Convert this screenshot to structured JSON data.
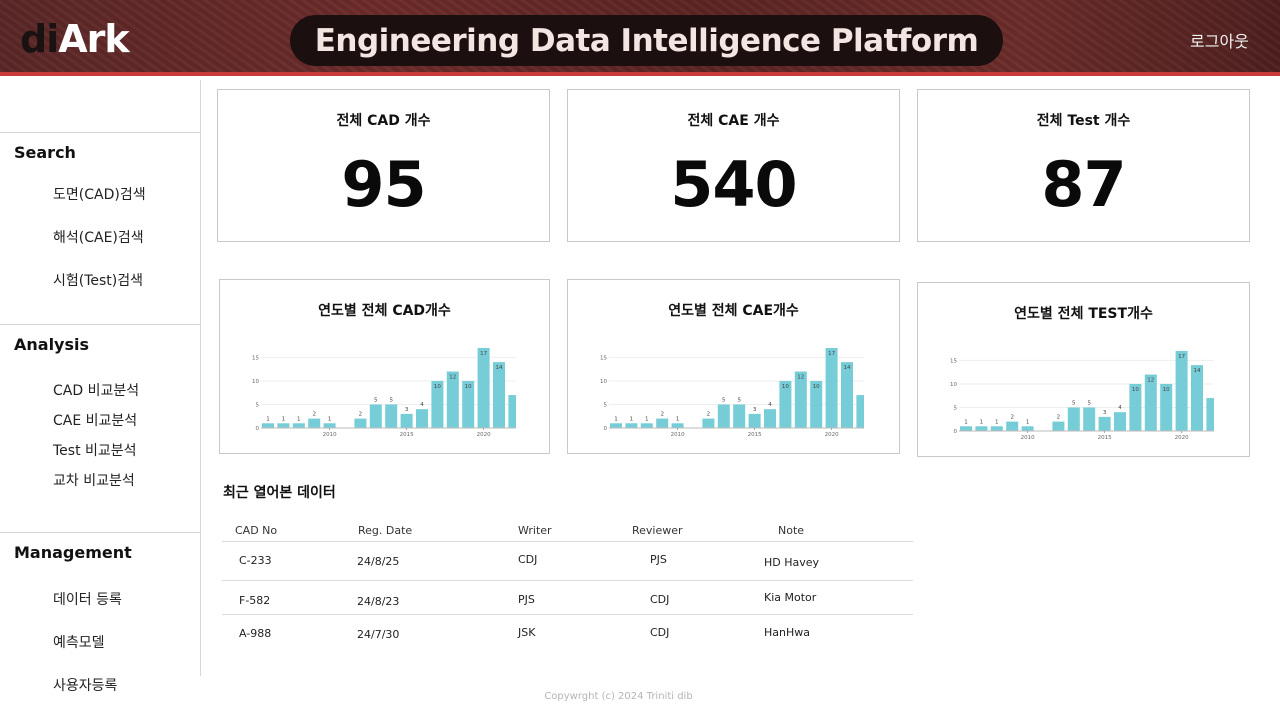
{
  "header": {
    "logo_di": "di",
    "logo_ark": "Ark",
    "title": "Engineering Data Intelligence Platform",
    "logout_label": "로그아웃"
  },
  "sidebar": {
    "sections": [
      {
        "title": "Search",
        "items": [
          "도면(CAD)검색",
          "해석(CAE)검색",
          "시험(Test)검색"
        ]
      },
      {
        "title": "Analysis",
        "items": [
          "CAD 비교분석",
          "CAE 비교분석",
          "Test 비교분석",
          "교차 비교분석"
        ]
      },
      {
        "title": "Management",
        "items": [
          "데이터 등록",
          "예측모델",
          "사용자등록"
        ]
      }
    ]
  },
  "stats": [
    {
      "label": "전체 CAD 개수",
      "value": "95"
    },
    {
      "label": "전체 CAE 개수",
      "value": "540"
    },
    {
      "label": "전체 Test 개수",
      "value": "87"
    }
  ],
  "chart_data": [
    {
      "type": "bar",
      "title": "연도별 전체 CAD개수",
      "x": [
        2007,
        2008,
        2009,
        2010,
        2011,
        2012,
        2013,
        2014,
        2015,
        2016,
        2017,
        2018,
        2019,
        2020,
        2021,
        2022
      ],
      "values": [
        1,
        1,
        1,
        2,
        1,
        0,
        2,
        5,
        5,
        3,
        4,
        10,
        12,
        10,
        17,
        14,
        7
      ],
      "data_labels": [
        "1",
        "1",
        "1",
        "2",
        "1",
        "",
        "2",
        "5",
        "5",
        "3",
        "4",
        "10",
        "12",
        "10",
        "17",
        "14",
        ""
      ],
      "yticks": [
        "0",
        "5",
        "10",
        "15"
      ],
      "xticks": [
        "2010",
        "2015",
        "2020"
      ],
      "ylim": [
        0,
        17
      ]
    },
    {
      "type": "bar",
      "title": "연도별 전체 CAE개수",
      "values": [
        1,
        1,
        1,
        2,
        1,
        0,
        2,
        5,
        5,
        3,
        4,
        10,
        12,
        10,
        17,
        14,
        7
      ],
      "data_labels": [
        "1",
        "1",
        "1",
        "2",
        "1",
        "",
        "2",
        "5",
        "5",
        "3",
        "4",
        "10",
        "12",
        "10",
        "17",
        "14",
        ""
      ],
      "yticks": [
        "0",
        "5",
        "10",
        "15"
      ],
      "xticks": [
        "2010",
        "2015",
        "2020"
      ],
      "ylim": [
        0,
        17
      ]
    },
    {
      "type": "bar",
      "title": "연도별 전체 TEST개수",
      "values": [
        1,
        1,
        1,
        2,
        1,
        0,
        2,
        5,
        5,
        3,
        4,
        10,
        12,
        10,
        17,
        14,
        7
      ],
      "data_labels": [
        "1",
        "1",
        "1",
        "2",
        "1",
        "",
        "2",
        "5",
        "5",
        "3",
        "4",
        "10",
        "12",
        "10",
        "17",
        "14",
        ""
      ],
      "yticks": [
        "0",
        "5",
        "10",
        "15"
      ],
      "xticks": [
        "2010",
        "2015",
        "2020"
      ],
      "ylim": [
        0,
        17
      ]
    }
  ],
  "recent": {
    "title": "최근 열어본 데이터",
    "columns": [
      "CAD No",
      "Reg. Date",
      "Writer",
      "Reviewer",
      "Note"
    ],
    "rows": [
      [
        "C-233",
        "24/8/25",
        "CDJ",
        "PJS",
        "HD Havey"
      ],
      [
        "F-582",
        "24/8/23",
        "PJS",
        "CDJ",
        "Kia Motor"
      ],
      [
        "A-988",
        "24/7/30",
        "JSK",
        "CDJ",
        "HanHwa"
      ]
    ]
  },
  "footer": "Copywrght (c) 2024  Triniti dib",
  "colors": {
    "bar": "#76cdd8",
    "header_accent": "#c93a3a",
    "header_bg": "#5a2626"
  }
}
